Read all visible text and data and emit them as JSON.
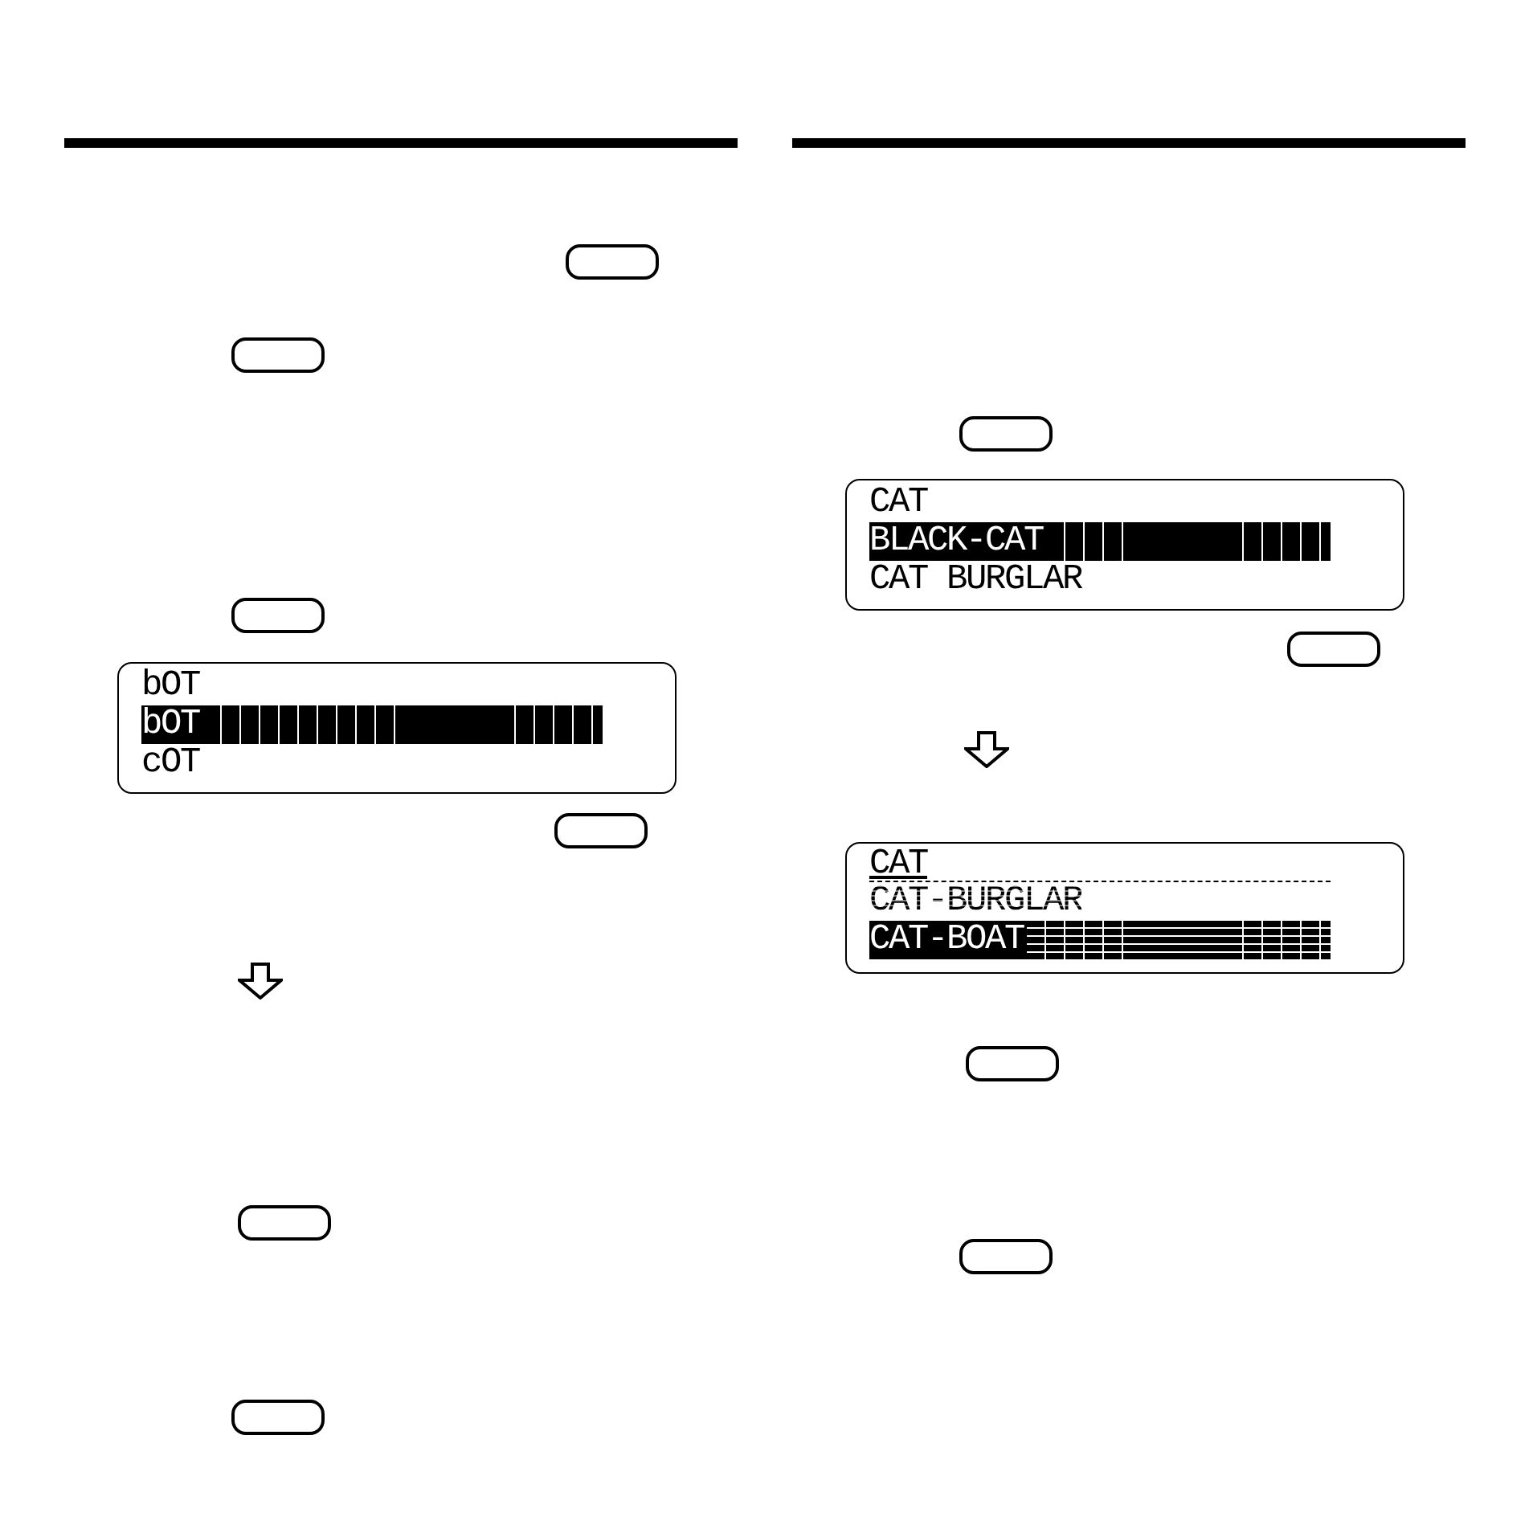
{
  "columns": [
    {
      "items": [
        {
          "kind": "key"
        },
        {
          "kind": "key"
        },
        {
          "kind": "key"
        },
        {
          "kind": "screen",
          "lines": [
            {
              "text": "bOT",
              "kind": "plain",
              "selected": false
            },
            {
              "text": "bOT",
              "kind": "plain",
              "selected": true
            },
            {
              "text": "cOT",
              "kind": "plain",
              "selected": false
            }
          ]
        },
        {
          "kind": "key"
        },
        {
          "kind": "arrow"
        },
        {
          "kind": "key"
        },
        {
          "kind": "key"
        }
      ]
    },
    {
      "items": [
        {
          "kind": "key"
        },
        {
          "kind": "screen",
          "lines": [
            {
              "text": "CAT",
              "kind": "plain",
              "selected": false
            },
            {
              "text": "BLACK-CAT",
              "kind": "plain",
              "selected": true
            },
            {
              "text": "CAT BURGLAR",
              "kind": "plain",
              "selected": false
            }
          ]
        },
        {
          "kind": "key"
        },
        {
          "kind": "arrow"
        },
        {
          "kind": "screen",
          "lines": [
            {
              "text": "CAT",
              "kind": "underlined",
              "selected": false
            },
            {
              "text": "CAT-BURGLAR",
              "kind": "dotted",
              "selected": false
            },
            {
              "text": "CAT-BOAT",
              "kind": "striped",
              "selected": true
            }
          ]
        },
        {
          "kind": "key"
        },
        {
          "kind": "key"
        }
      ]
    }
  ]
}
